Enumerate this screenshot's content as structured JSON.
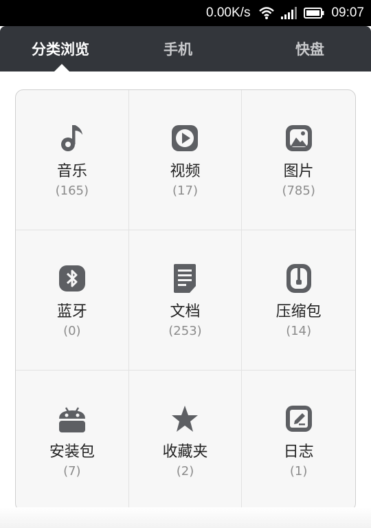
{
  "status_bar": {
    "speed": "0.00K/s",
    "time": "09:07",
    "icons": [
      "wifi-icon",
      "signal-icon",
      "battery-icon"
    ]
  },
  "tabs": [
    {
      "label": "分类浏览",
      "active": true
    },
    {
      "label": "手机",
      "active": false
    },
    {
      "label": "快盘",
      "active": false
    }
  ],
  "categories": [
    {
      "label": "音乐",
      "count": "(165)",
      "icon": "music-note-icon"
    },
    {
      "label": "视频",
      "count": "(17)",
      "icon": "video-play-icon"
    },
    {
      "label": "图片",
      "count": "(785)",
      "icon": "picture-icon"
    },
    {
      "label": "蓝牙",
      "count": "(0)",
      "icon": "bluetooth-icon"
    },
    {
      "label": "文档",
      "count": "(253)",
      "icon": "document-icon"
    },
    {
      "label": "压缩包",
      "count": "(14)",
      "icon": "zip-archive-icon"
    },
    {
      "label": "安装包",
      "count": "(7)",
      "icon": "android-icon"
    },
    {
      "label": "收藏夹",
      "count": "(2)",
      "icon": "star-icon"
    },
    {
      "label": "日志",
      "count": "(1)",
      "icon": "log-edit-icon"
    }
  ],
  "colors": {
    "tab_bar": "#33363b",
    "icon": "#5d5f63",
    "card_bg": "#f7f7f7"
  }
}
